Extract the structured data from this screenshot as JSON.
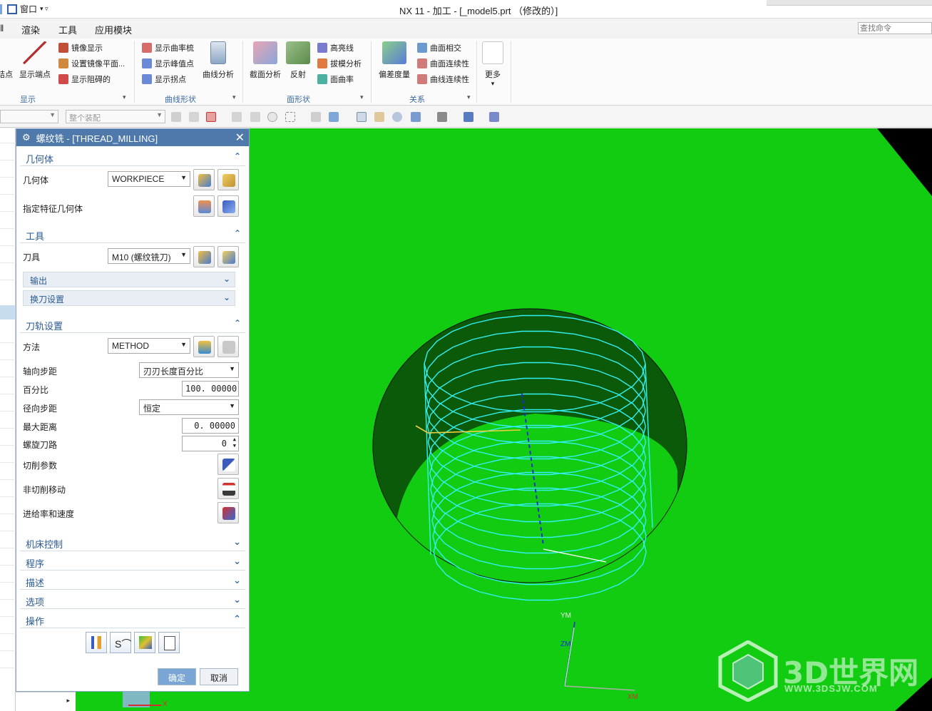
{
  "titlebar": {
    "window_menu": "窗口",
    "window_arrow": "▾ ▿",
    "title": "NX 11 - 加工 - [_model5.prt （修改的）]"
  },
  "menubar": {
    "items": [
      "渲染",
      "工具",
      "应用模块"
    ],
    "search_placeholder": "查找命令"
  },
  "ribbon": {
    "display": {
      "items": [
        "镜像显示",
        "设置镜像平面...",
        "显示阻碍的"
      ],
      "big": [
        "显示端点"
      ],
      "cut_label": "结点",
      "group": "显示"
    },
    "curve_shape": {
      "items": [
        "显示曲率梳",
        "显示峰值点",
        "显示拐点"
      ],
      "big": [
        "曲线分析"
      ],
      "group": "曲线形状"
    },
    "face_shape": {
      "big": [
        "截面分析",
        "反射"
      ],
      "items": [
        "高亮线",
        "拔模分析",
        "面曲率"
      ],
      "group": "面形状"
    },
    "relations": {
      "big": [
        "偏差度量"
      ],
      "items": [
        "曲面相交",
        "曲面连续性",
        "曲线连续性"
      ],
      "group": "关系"
    },
    "more": "更多"
  },
  "toolbar2": {
    "combo_assembly": "整个装配"
  },
  "dialog": {
    "title": "螺纹铣 - [THREAD_MILLING]",
    "geometry": {
      "header": "几何体",
      "geometry_label": "几何体",
      "geometry_value": "WORKPIECE",
      "feature_label": "指定特征几何体"
    },
    "tool": {
      "header": "工具",
      "tool_label": "刀具",
      "tool_value": "M10 (螺纹铣刀)",
      "output": "输出",
      "tool_change": "换刀设置"
    },
    "path": {
      "header": "刀轨设置",
      "method_label": "方法",
      "method_value": "METHOD",
      "axial_label": "轴向步距",
      "axial_value": "刃刃长度百分比",
      "percent_label": "百分比",
      "percent_value": "100. 00000",
      "radial_label": "径向步距",
      "radial_value": "恒定",
      "maxdist_label": "最大距离",
      "maxdist_value": "0. 00000",
      "helix_label": "螺旋刀路",
      "helix_value": "0",
      "cut_params": "切削参数",
      "noncut": "非切削移动",
      "feeds": "进给率和速度"
    },
    "collapsed": [
      "机床控制",
      "程序",
      "描述",
      "选项"
    ],
    "actions_header": "操作",
    "ok": "确定",
    "cancel": "取消"
  },
  "viewport": {
    "axes": {
      "ym": "YM",
      "zm": "ZM",
      "xm": "XM",
      "x": "X"
    },
    "watermark": "3D世界网",
    "watermark_url": "WWW.3DSJW.COM",
    "colors": {
      "background": "#12cc12",
      "wall": "#0a5a0a",
      "toolpath": "#33f0f0"
    }
  }
}
